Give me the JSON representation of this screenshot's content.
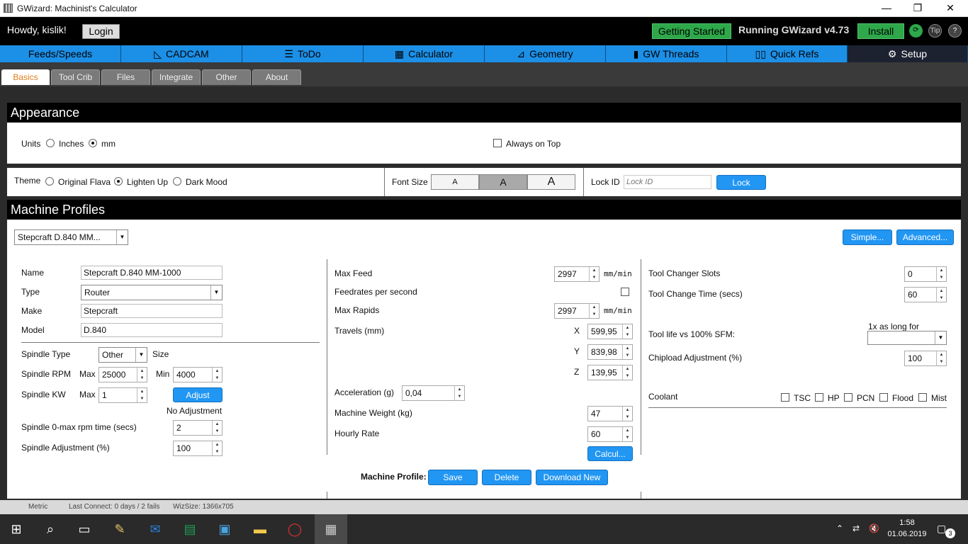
{
  "window": {
    "title": "GWizard: Machinist's Calculator",
    "min": "—",
    "max": "❐",
    "close": "✕"
  },
  "topbar": {
    "greeting": "Howdy, kislik!",
    "login": "Login",
    "getting_started": "Getting Started",
    "running": "Running GWizard v4.73",
    "install": "Install",
    "tip": "Tip",
    "help": "?"
  },
  "main_tabs": [
    {
      "label": "Feeds/Speeds",
      "icon": ""
    },
    {
      "label": "CADCAM",
      "icon": "📐"
    },
    {
      "label": "ToDo",
      "icon": "☰"
    },
    {
      "label": "Calculator",
      "icon": "▦"
    },
    {
      "label": "Geometry",
      "icon": "⊿"
    },
    {
      "label": "GW Threads",
      "icon": "▮"
    },
    {
      "label": "Quick Refs",
      "icon": "📖"
    },
    {
      "label": "Setup",
      "icon": "⚙"
    }
  ],
  "sub_tabs": [
    "Basics",
    "Tool Crib",
    "Files",
    "Integrate",
    "Other",
    "About"
  ],
  "appearance": {
    "heading": "Appearance",
    "units_label": "Units",
    "inches": "Inches",
    "mm": "mm",
    "always_on_top": "Always on Top",
    "theme_label": "Theme",
    "theme_original": "Original Flava",
    "theme_lighten": "Lighten Up",
    "theme_dark": "Dark Mood",
    "font_size_label": "Font Size",
    "font_a": "A",
    "lock_id_label": "Lock ID",
    "lock_id_placeholder": "Lock ID",
    "lock_button": "Lock"
  },
  "profiles": {
    "heading": "Machine Profiles",
    "selected": "Stepcraft D.840 MM...",
    "simple": "Simple...",
    "advanced": "Advanced...",
    "name_label": "Name",
    "name": "Stepcraft D.840 MM-1000",
    "type_label": "Type",
    "type": "Router",
    "make_label": "Make",
    "make": "Stepcraft",
    "model_label": "Model",
    "model": "D.840",
    "spindle_type_label": "Spindle Type",
    "spindle_type": "Other",
    "size_label": "Size",
    "spindle_rpm_label": "Spindle RPM",
    "max_label": "Max",
    "min_label": "Min",
    "rpm_max": "25000",
    "rpm_min": "4000",
    "spindle_kw_label": "Spindle KW",
    "kw_max": "1",
    "adjust": "Adjust",
    "no_adjustment": "No Adjustment",
    "rpm_time_label": "Spindle 0-max rpm time (secs)",
    "rpm_time": "2",
    "spindle_adj_label": "Spindle Adjustment (%)",
    "spindle_adj": "100",
    "max_feed_label": "Max Feed",
    "max_feed": "2997",
    "unit_mm_min": "mm/min",
    "feed_per_sec_label": "Feedrates per second",
    "max_rapids_label": "Max Rapids",
    "max_rapids": "2997",
    "travels_label": "Travels (mm)",
    "x_label": "X",
    "y_label": "Y",
    "z_label": "Z",
    "travel_x": "599,95",
    "travel_y": "839,98",
    "travel_z": "139,95",
    "accel_label": "Acceleration (g)",
    "accel": "0,04",
    "weight_label": "Machine Weight (kg)",
    "weight": "47",
    "hourly_label": "Hourly Rate",
    "hourly": "60",
    "calcul": "Calcul...",
    "tc_slots_label": "Tool Changer Slots",
    "tc_slots": "0",
    "tc_time_label": "Tool Change Time (secs)",
    "tc_time": "60",
    "tool_life_label": "Tool life vs 100% SFM:",
    "tool_life_hint": "1x as long for",
    "chipload_label": "Chipload Adjustment (%)",
    "chipload": "100",
    "coolant_label": "Coolant",
    "tsc": "TSC",
    "hp": "HP",
    "pcn": "PCN",
    "flood": "Flood",
    "mist": "Mist",
    "footer_label": "Machine Profile:",
    "save": "Save",
    "delete": "Delete",
    "download_new": "Download New"
  },
  "status": {
    "metric": "Metric",
    "last_connect": "Last Connect: 0 days / 2 fails",
    "wizsize": "WizSize: 1366x705"
  },
  "taskbar": {
    "time": "1:58",
    "date": "01.06.2019",
    "notifications": "3"
  }
}
